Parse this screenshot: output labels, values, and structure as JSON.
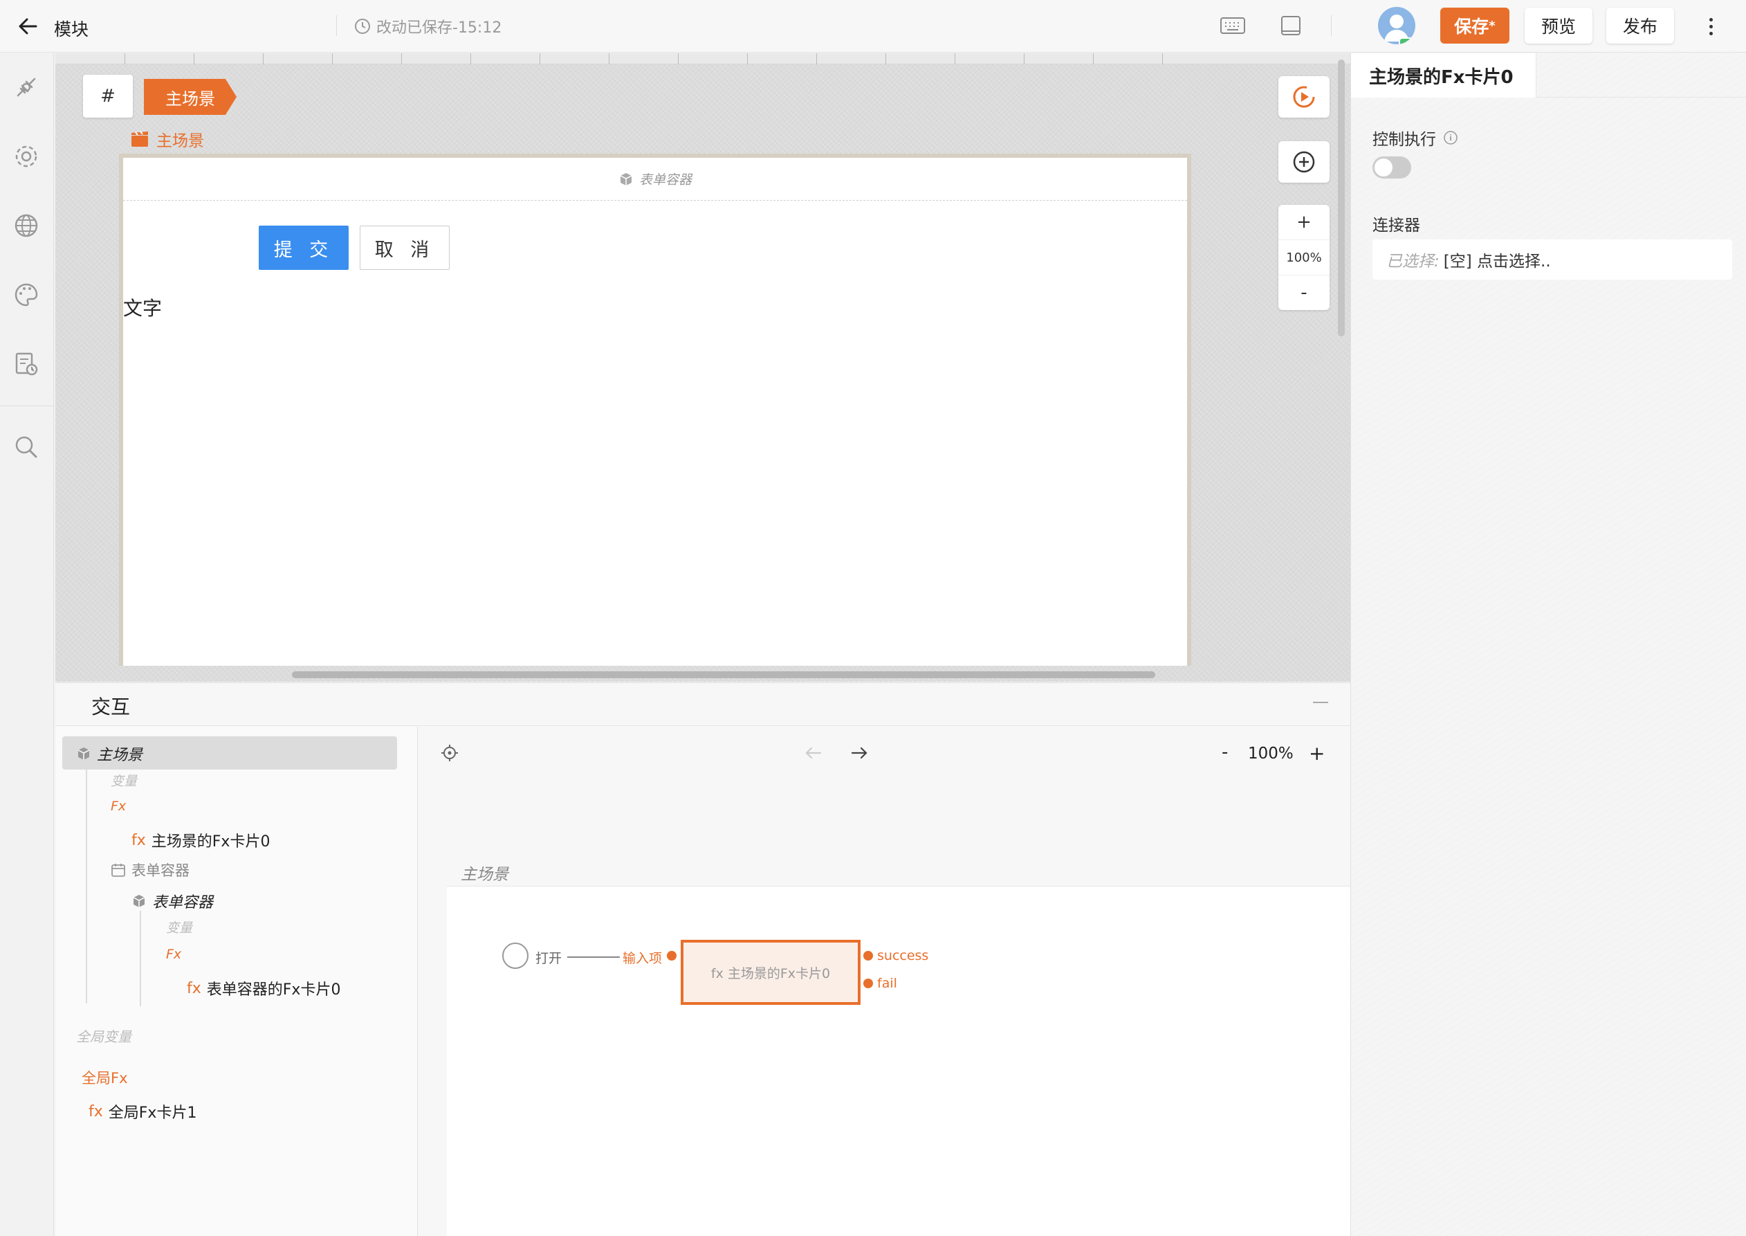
{
  "topbar": {
    "title": "模块",
    "saved_status": "改动已保存-15:12",
    "save_label": "保存",
    "save_dirty_mark": "*",
    "preview_label": "预览",
    "publish_label": "发布"
  },
  "canvas": {
    "hash_label": "#",
    "scene_tag": "主场景",
    "scene_sub_label": "主场景",
    "form_container_label": "表单容器",
    "submit_label": "提 交",
    "cancel_label": "取 消",
    "text_label": "文字",
    "zoom_in": "+",
    "zoom_level": "100%",
    "zoom_out": "-"
  },
  "interaction": {
    "title": "交互",
    "tree": {
      "root": "主场景",
      "root_vars": "变量",
      "root_fx": "Fx",
      "root_fx_item": "主场景的Fx卡片0",
      "form_container_group": "表单容器",
      "form_container": "表单容器",
      "fc_vars": "变量",
      "fc_fx": "Fx",
      "fc_fx_item": "表单容器的Fx卡片0",
      "global_vars": "全局变量",
      "global_fx": "全局Fx",
      "global_fx_item": "全局Fx卡片1",
      "fx_prefix": "fx"
    },
    "flow": {
      "zoom_minus": "-",
      "zoom_level": "100%",
      "zoom_plus": "+",
      "scene_label": "主场景",
      "open_label": "打开",
      "input_label": "输入项",
      "card_label": "fx 主场景的Fx卡片0",
      "success_label": "success",
      "fail_label": "fail"
    }
  },
  "rightpanel": {
    "tab_title": "主场景的Fx卡片0",
    "control_label": "控制执行",
    "connector_label": "连接器",
    "connector_selected_prefix": "已选择:",
    "connector_value": "[空] 点击选择.."
  },
  "colors": {
    "accent": "#e86f2b",
    "primary": "#3a8ef0"
  }
}
